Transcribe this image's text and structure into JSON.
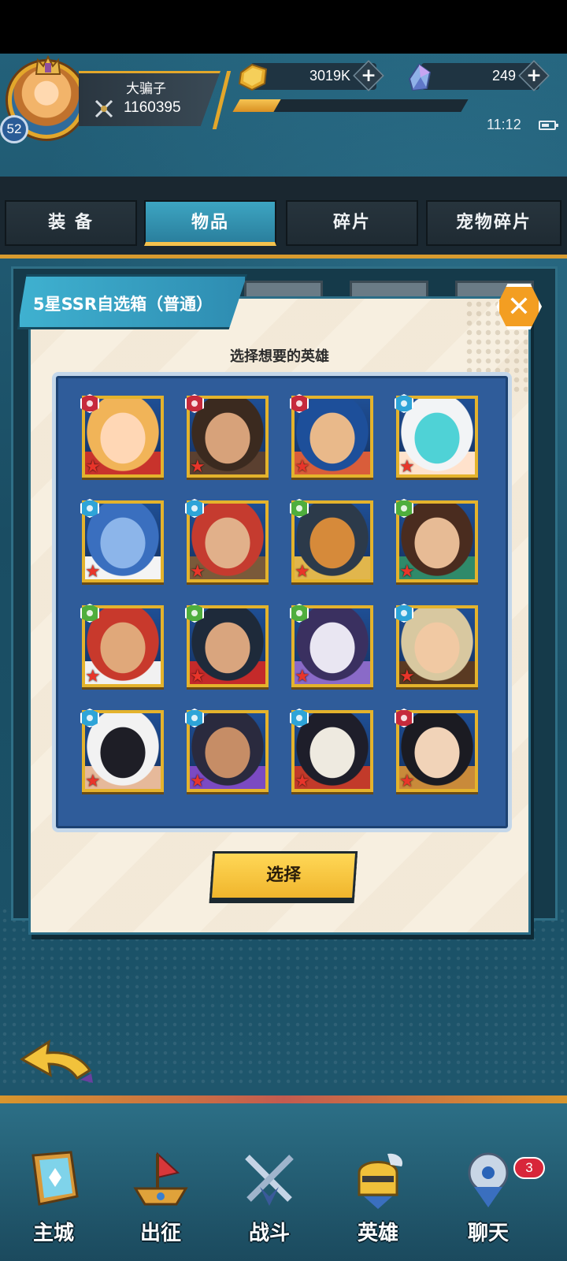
{
  "player": {
    "name": "大骗子",
    "power": "1160395",
    "level": "52",
    "exp_progress": 0.18
  },
  "resources": {
    "gold": "3019K",
    "gems": "249"
  },
  "status": {
    "time": "11:12"
  },
  "tabs": [
    {
      "label": "装 备",
      "active": false
    },
    {
      "label": "物品",
      "active": true
    },
    {
      "label": "碎片",
      "active": false
    },
    {
      "label": "宠物碎片",
      "active": false
    }
  ],
  "dialog": {
    "title": "5星SSR自选箱（普通）",
    "subtitle": "选择想要的英雄",
    "select_label": "选择",
    "close_label": "✕"
  },
  "heroes": [
    {
      "element": "fire",
      "stars": 1,
      "icon": "blonde-heroine-portrait"
    },
    {
      "element": "fire",
      "stars": 1,
      "icon": "bearded-warrior-portrait"
    },
    {
      "element": "fire",
      "stars": 1,
      "icon": "rabbit-mage-portrait"
    },
    {
      "element": "water",
      "stars": 1,
      "icon": "teal-hair-girl-portrait"
    },
    {
      "element": "water",
      "stars": 1,
      "icon": "blue-beast-portrait"
    },
    {
      "element": "water",
      "stars": 1,
      "icon": "pirate-dwarf-portrait"
    },
    {
      "element": "nature",
      "stars": 1,
      "icon": "cat-knight-portrait"
    },
    {
      "element": "nature",
      "stars": 1,
      "icon": "tribal-woman-portrait"
    },
    {
      "element": "nature",
      "stars": 1,
      "icon": "red-hair-brawler-portrait"
    },
    {
      "element": "nature",
      "stars": 1,
      "icon": "masked-assassin-portrait"
    },
    {
      "element": "nature",
      "stars": 1,
      "icon": "white-hair-sorceress-portrait"
    },
    {
      "element": "water",
      "stars": 1,
      "icon": "helmet-boy-portrait"
    },
    {
      "element": "water",
      "stars": 1,
      "icon": "snow-hood-girl-portrait"
    },
    {
      "element": "water",
      "stars": 1,
      "icon": "headband-fighter-portrait"
    },
    {
      "element": "water",
      "stars": 1,
      "icon": "skeleton-pirate-portrait"
    },
    {
      "element": "fire",
      "stars": 1,
      "icon": "black-hair-girl-portrait"
    }
  ],
  "nav": [
    {
      "label": "主城",
      "icon": "castle-book-icon"
    },
    {
      "label": "出征",
      "icon": "ship-icon"
    },
    {
      "label": "战斗",
      "icon": "crossed-swords-icon"
    },
    {
      "label": "英雄",
      "icon": "knight-helmet-icon"
    },
    {
      "label": "聊天",
      "icon": "chat-bubble-icon",
      "badge": "3"
    }
  ],
  "colors": {
    "accent_gold": "#e4b32c",
    "tab_active": "#3da5c2",
    "grid_bg": "#2f5c9a",
    "fire": "#c62a3c",
    "water": "#2ea4d8",
    "nature": "#4fae3d"
  }
}
